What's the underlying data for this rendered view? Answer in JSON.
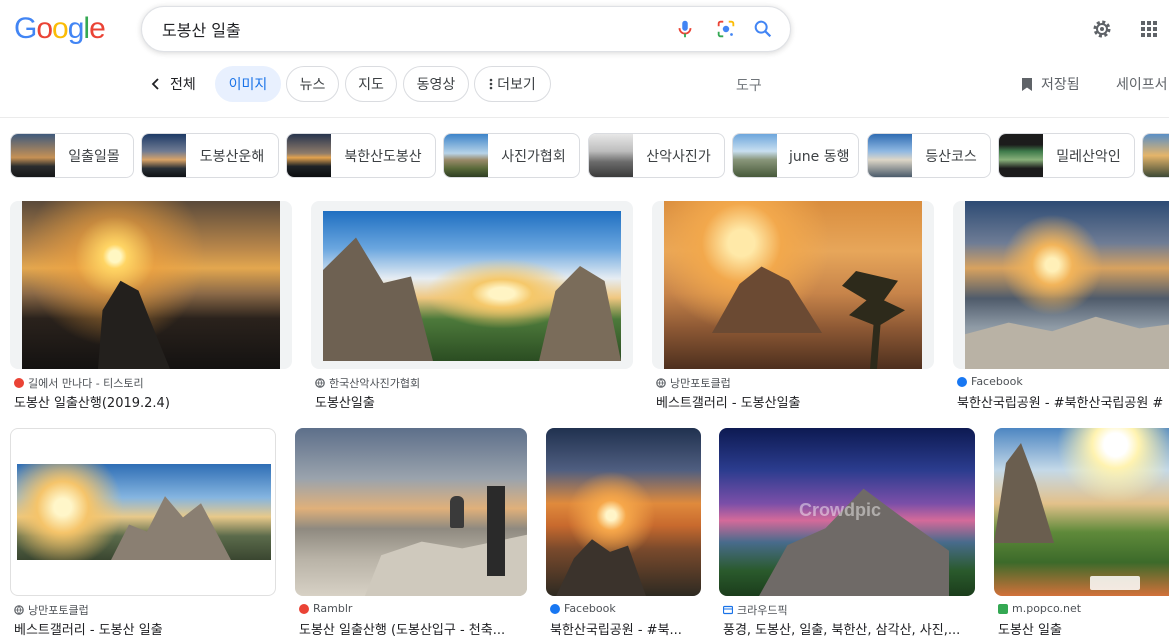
{
  "logo": {
    "letters": [
      "G",
      "o",
      "o",
      "g",
      "l",
      "e"
    ],
    "colors": [
      "#4285F4",
      "#EA4335",
      "#FBBC05",
      "#4285F4",
      "#34A853",
      "#EA4335"
    ]
  },
  "search": {
    "value": "도봉산 일출",
    "mic_icon": "mic-icon",
    "lens_icon": "lens-icon",
    "search_icon": "search-icon"
  },
  "header": {
    "settings_icon": "gear-icon",
    "apps_icon": "apps-grid-icon"
  },
  "tabs": {
    "all": "전체",
    "images": "이미지",
    "news": "뉴스",
    "maps": "지도",
    "videos": "동영상",
    "more": "더보기",
    "tools": "도구",
    "saved": "저장됨",
    "safesearch": "세이프서"
  },
  "accent": "#1a73e8",
  "related": [
    {
      "label": "일출일몰"
    },
    {
      "label": "도봉산운해"
    },
    {
      "label": "북한산도봉산"
    },
    {
      "label": "사진가협회"
    },
    {
      "label": "산악사진가"
    },
    {
      "label": "june 동행"
    },
    {
      "label": "등산코스"
    },
    {
      "label": "밀레산악인"
    }
  ],
  "results": [
    {
      "source": "길에서 만나다 - 티스토리",
      "title": "도봉산 일출산행(2019.2.4)",
      "favicon_color": "#ea4335"
    },
    {
      "source": "한국산악사진가협회",
      "title": "도봉산일출",
      "favicon_color": "#5f6368"
    },
    {
      "source": "낭만포토클럽",
      "title": "베스트갤러리 - 도봉산일출",
      "favicon_color": "#5f6368"
    },
    {
      "source": "Facebook",
      "title": "북한산국립공원 - #북한산국립공원 #",
      "favicon_color": "#1877f2"
    },
    {
      "source": "낭만포토클럽",
      "title": "베스트갤러리 - 도봉산 일출",
      "favicon_color": "#5f6368"
    },
    {
      "source": "Ramblr",
      "title": "도봉산 일출산행 (도봉산입구 - 천축...",
      "favicon_color": "#ea4335"
    },
    {
      "source": "Facebook",
      "title": "북한산국립공원 - #북...",
      "favicon_color": "#1877f2"
    },
    {
      "source": "크라우드픽",
      "title": "풍경, 도봉산, 일출, 북한산, 삼각산, 사진,...",
      "favicon_color": "#1a73e8"
    },
    {
      "source": "m.popco.net",
      "title": "도봉산 일출",
      "favicon_color": "#34a853"
    }
  ],
  "watermarks": {
    "crowdpic": "Crowdpic"
  }
}
